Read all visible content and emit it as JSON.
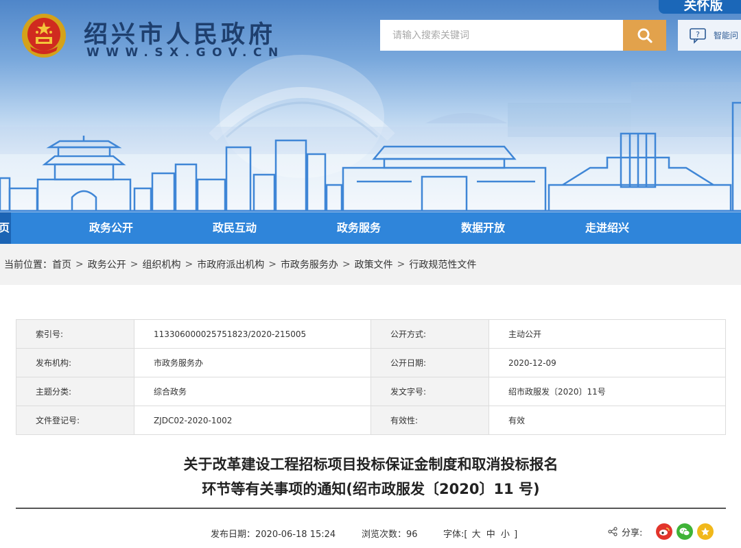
{
  "header": {
    "site_title": "绍兴市人民政府",
    "site_domain": "WWW.SX.GOV.CN",
    "care_mode_label": "关怀版",
    "search_placeholder": "请输入搜索关键词",
    "smart_qa_label": "智能问"
  },
  "nav": {
    "items": [
      {
        "label": "页"
      },
      {
        "label": "政务公开"
      },
      {
        "label": "政民互动"
      },
      {
        "label": "政务服务"
      },
      {
        "label": "数据开放"
      },
      {
        "label": "走进绍兴"
      }
    ]
  },
  "breadcrumb": {
    "prefix": "当前位置：",
    "items": [
      "首页",
      "政务公开",
      "组织机构",
      "市政府派出机构",
      "市政务服务办",
      "政策文件",
      "行政规范性文件"
    ],
    "separator": ">"
  },
  "info_table": {
    "rows": [
      {
        "k1": "索引号:",
        "v1": "113306000025751823/2020-215005",
        "k2": "公开方式:",
        "v2": "主动公开"
      },
      {
        "k1": "发布机构:",
        "v1": "市政务服务办",
        "k2": "公开日期:",
        "v2": "2020-12-09"
      },
      {
        "k1": "主题分类:",
        "v1": "综合政务",
        "k2": "发文字号:",
        "v2": "绍市政服发〔2020〕11号"
      },
      {
        "k1": "文件登记号:",
        "v1": "ZJDC02-2020-1002",
        "k2": "有效性:",
        "v2": "有效"
      }
    ]
  },
  "document": {
    "title_line1": "关于改革建设工程招标项目投标保证金制度和取消投标报名",
    "title_line2": "环节等有关事项的通知(绍市政服发〔2020〕11 号)"
  },
  "meta": {
    "publish_label": "发布日期：",
    "publish_date": "2020-06-18 15:24",
    "views_label": "浏览次数：",
    "views": "96",
    "font_label": "字体:[",
    "font_large": "大",
    "font_medium": "中",
    "font_small": "小",
    "font_close": "]",
    "share_label": "分享:"
  },
  "colors": {
    "nav_bg": "#2f85da",
    "nav_active": "#1c64b4",
    "search_button": "#e2a24c",
    "title_blue": "#1e3f6e",
    "weibo": "#e2352b",
    "wechat": "#3fb337",
    "favorite": "#f1b81a"
  },
  "icons": {
    "search_button": "search-icon",
    "smart_qa": "chat-question-icon",
    "share": "share-icon",
    "weibo": "weibo-icon",
    "wechat": "wechat-icon",
    "favorite": "star-icon",
    "emblem": "national-emblem"
  }
}
